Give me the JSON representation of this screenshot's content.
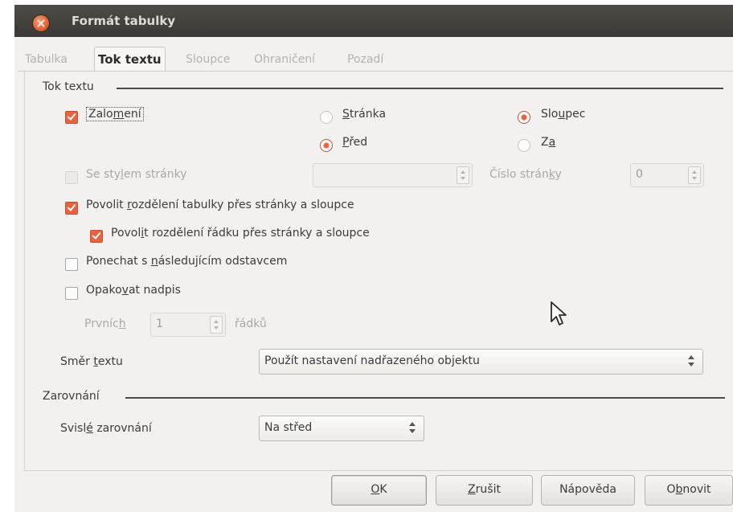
{
  "window": {
    "title": "Formát tabulky"
  },
  "tabs": [
    {
      "label": "Tabulka",
      "active": false
    },
    {
      "label": "Tok textu",
      "active": true
    },
    {
      "label": "Sloupce",
      "active": false
    },
    {
      "label": "Ohraničení",
      "active": false
    },
    {
      "label": "Pozadí",
      "active": false
    }
  ],
  "text_flow": {
    "section_label": "Tok textu",
    "break": {
      "label_pre": "Zalo",
      "label_mn": "m",
      "label_post": "ení",
      "checked": true
    },
    "page_radio": {
      "mn": "S",
      "rest": "tránka",
      "selected": false
    },
    "column_radio": {
      "pre": "Slo",
      "mn": "u",
      "post": "pec",
      "selected": true
    },
    "before_radio": {
      "mn": "P",
      "rest": "řed",
      "selected": true
    },
    "after_radio": {
      "pre": "Z",
      "mn": "a",
      "selected": false
    },
    "with_page_style": {
      "pre": "Se sty",
      "mn": "l",
      "post": "em stránky",
      "checked": false,
      "enabled": false
    },
    "page_style_value": "",
    "page_number_label": {
      "pre": "Číslo strán",
      "mn": "k",
      "post": "y"
    },
    "page_number_value": "0",
    "allow_table_split": {
      "pre": "Povolit ",
      "mn": "r",
      "post": "ozdělení tabulky přes stránky a sloupce",
      "checked": true
    },
    "allow_row_split": {
      "pre": "Povol",
      "mn": "i",
      "post": "t rozdělení řádku přes stránky a sloupce",
      "checked": true
    },
    "keep_with_next": {
      "pre": "Ponechat s ",
      "mn": "n",
      "post": "ásledujícím odstavcem",
      "checked": false
    },
    "repeat_heading": {
      "pre": "Opako",
      "mn": "v",
      "post": "at nadpis",
      "checked": false
    },
    "first_label": {
      "pre": "Prvníc",
      "mn": "h"
    },
    "first_value": "1",
    "rows_label": "řádků",
    "text_direction_label": {
      "pre": "Směr ",
      "mn": "t",
      "post": "extu"
    },
    "text_direction_value": "Použít nastavení nadřazeného objektu"
  },
  "alignment": {
    "section_label": "Zarovnání",
    "vertical_label": {
      "pre": "Svisl",
      "mn": "é",
      "post": " zarovnání"
    },
    "vertical_value": "Na střed"
  },
  "buttons": {
    "ok": {
      "mn": "O",
      "post": "K"
    },
    "cancel": {
      "mn": "Z",
      "post": "rušit"
    },
    "help": "Nápověda",
    "reset": {
      "pre": "O",
      "mn": "b",
      "post": "novit"
    }
  },
  "colors": {
    "accent": "#e9613d",
    "titlebar": "#3c3b37",
    "dialog_bg": "#f2f1f0"
  }
}
